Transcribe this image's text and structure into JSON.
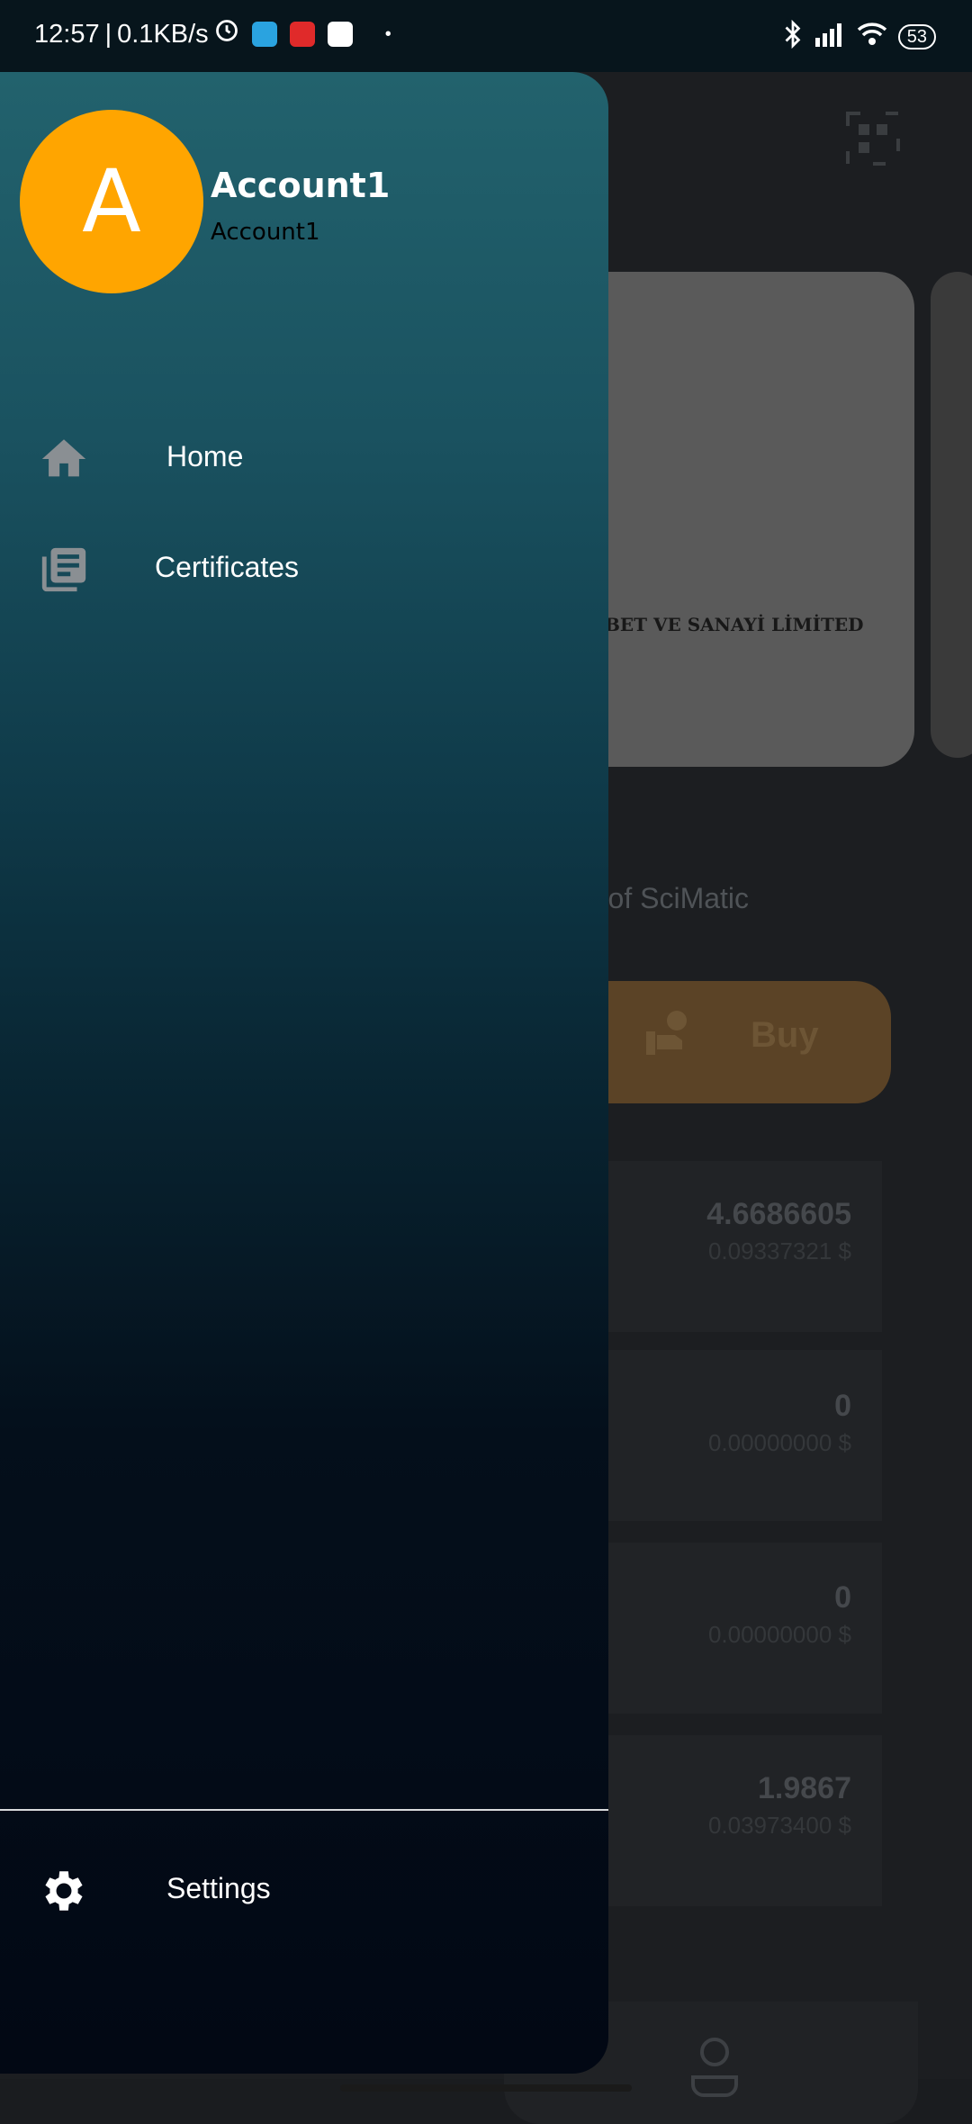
{
  "status_bar": {
    "time": "12:57",
    "speed": "0.1KB/s",
    "battery": "53"
  },
  "drawer": {
    "avatar_letter": "A",
    "account_name": "Account1",
    "account_sub": "Account1",
    "items": [
      {
        "label": "Home",
        "icon": "home-icon"
      },
      {
        "label": "Certificates",
        "icon": "document-icon"
      }
    ],
    "settings_label": "Settings"
  },
  "background": {
    "card_text": "BET VE SANAYİ LİMİTED",
    "caption": "rk of SciMatic",
    "buy_label": "Buy",
    "rows": [
      {
        "amount": "4.6686605",
        "usd": "0.09337321 $"
      },
      {
        "amount": "0",
        "usd": "0.00000000 $"
      },
      {
        "amount": "0",
        "usd": "0.00000000 $"
      },
      {
        "amount": "1.9867",
        "usd": "0.03973400 $"
      }
    ]
  },
  "colors": {
    "avatar": "#ffa500",
    "drawer_top": "#22626d",
    "drawer_bottom": "#020814"
  }
}
